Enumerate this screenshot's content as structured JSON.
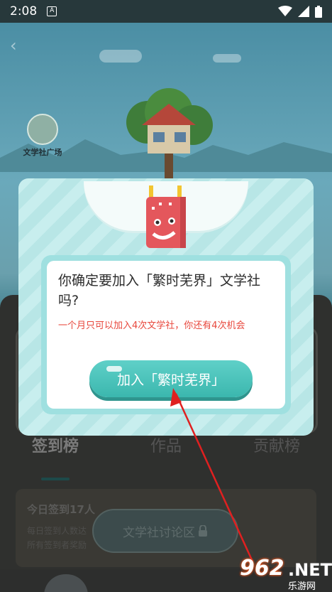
{
  "status_bar": {
    "time": "2:08",
    "notification": "A"
  },
  "background": {
    "plaza_label": "文学社广场",
    "tabs": [
      "签到榜",
      "作品",
      "贡献榜"
    ],
    "info_card": {
      "title": "今日签到17人",
      "line1": "每日签到人数达",
      "line2": "所有签到者奖励"
    },
    "discuss_button": "文学社讨论区",
    "lock_icon": "lock-icon"
  },
  "modal": {
    "question": "你确定要加入「繁时芜界」文学社吗?",
    "note": "一个月只可以加入4次文学社，你还有4次机会",
    "join_button": "加入「繁时芜界」"
  },
  "watermark": {
    "brand": "962",
    "net": ".NET",
    "sub": "乐游网"
  },
  "colors": {
    "accent": "#3bb7ae",
    "note": "#e8473c",
    "arrow": "#e02020"
  }
}
